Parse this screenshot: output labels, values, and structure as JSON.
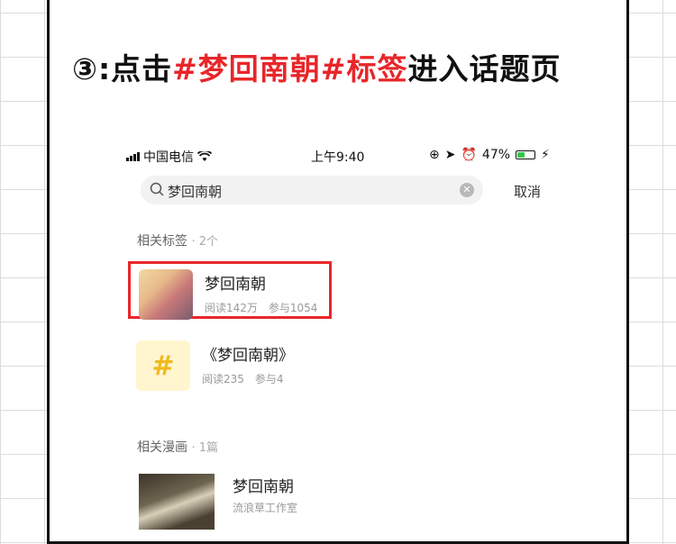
{
  "headline": {
    "step": "③",
    "prefix": ":点击",
    "tag": "#梦回南朝#标签",
    "suffix": "进入话题页"
  },
  "status_bar": {
    "carrier": "中国电信",
    "time": "上午9:40",
    "battery": "47%",
    "battery_level": 0.47
  },
  "search": {
    "query": "梦回南朝",
    "cancel_label": "取消"
  },
  "related_tags": {
    "label": "相关标签",
    "count": "· 2个",
    "items": [
      {
        "title": "梦回南朝",
        "reads": "阅读142万",
        "participants": "参与1054"
      },
      {
        "title": "《梦回南朝》",
        "reads": "阅读235",
        "participants": "参与4",
        "icon": "#"
      }
    ]
  },
  "related_comics": {
    "label": "相关漫画",
    "count": "· 1篇",
    "items": [
      {
        "title": "梦回南朝",
        "author": "流浪草工作室"
      }
    ]
  }
}
